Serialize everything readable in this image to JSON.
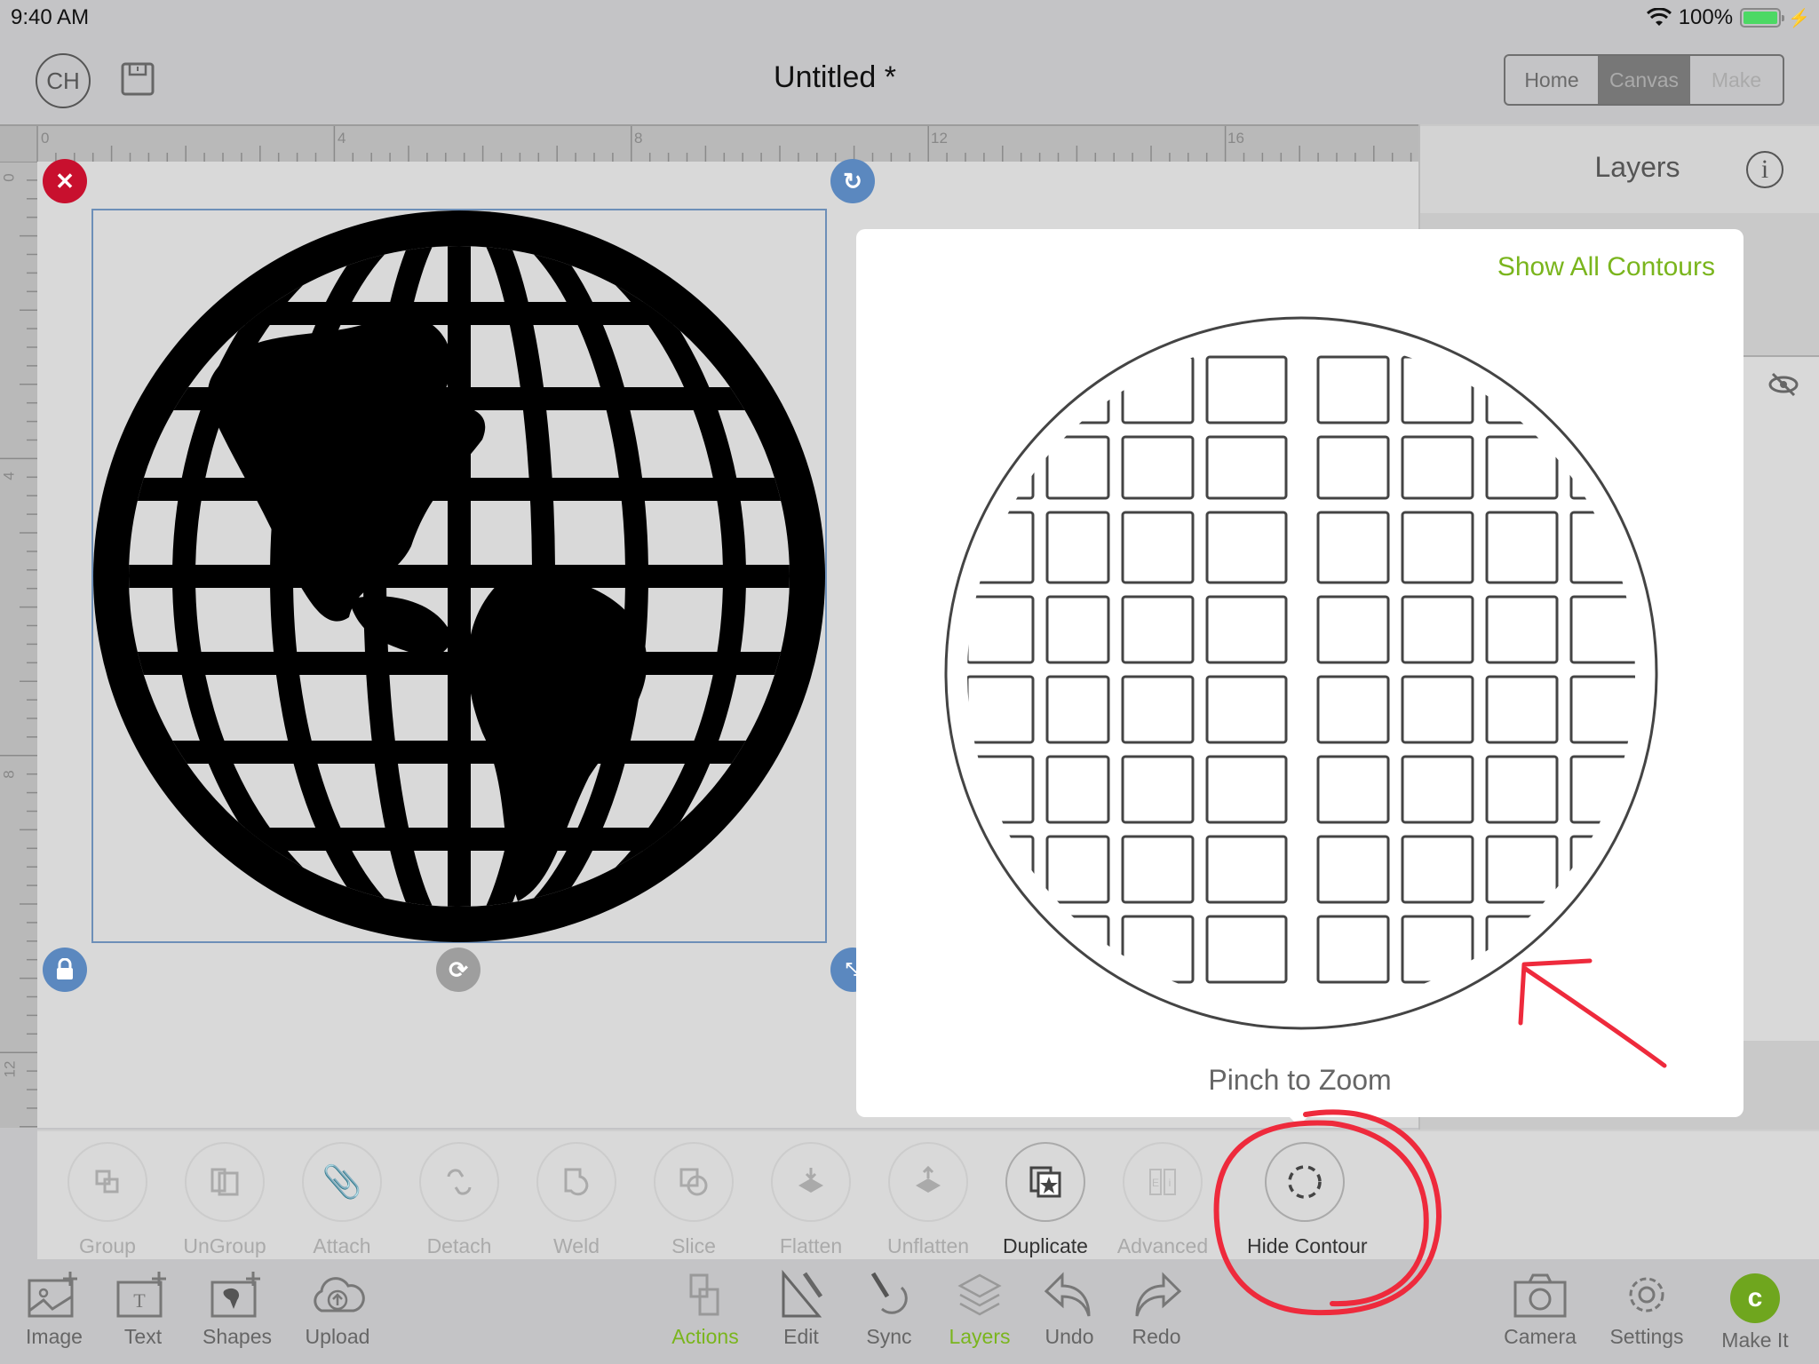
{
  "status_bar": {
    "time": "9:40 AM",
    "battery": "100%",
    "battery_level": 1.0
  },
  "header": {
    "avatar_initials": "CH",
    "title": "Untitled *",
    "nav": [
      {
        "label": "Home",
        "state": "normal"
      },
      {
        "label": "Canvas",
        "state": "active"
      },
      {
        "label": "Make",
        "state": "disabled"
      }
    ]
  },
  "rulers": {
    "horizontal_labels": [
      "0",
      "4",
      "8",
      "12",
      "16"
    ],
    "vertical_labels": [
      "0",
      "4",
      "8",
      "12"
    ],
    "corner_label": "0"
  },
  "layers_panel": {
    "title": "Layers"
  },
  "contour_popover": {
    "show_all_label": "Show All Contours",
    "hint": "Pinch to Zoom"
  },
  "action_bar": {
    "items": [
      {
        "label": "Group",
        "icon": "group-icon",
        "enabled": false
      },
      {
        "label": "UnGroup",
        "icon": "ungroup-icon",
        "enabled": false
      },
      {
        "label": "Attach",
        "icon": "paperclip-icon",
        "enabled": false
      },
      {
        "label": "Detach",
        "icon": "detach-icon",
        "enabled": false
      },
      {
        "label": "Weld",
        "icon": "weld-icon",
        "enabled": false
      },
      {
        "label": "Slice",
        "icon": "slice-icon",
        "enabled": false
      },
      {
        "label": "Flatten",
        "icon": "flatten-icon",
        "enabled": false
      },
      {
        "label": "Unflatten",
        "icon": "unflatten-icon",
        "enabled": false
      },
      {
        "label": "Duplicate",
        "icon": "duplicate-icon",
        "enabled": true
      },
      {
        "label": "Advanced",
        "icon": "advanced-icon",
        "enabled": false
      },
      {
        "label": "Hide Contour",
        "icon": "contour-icon",
        "enabled": true
      }
    ]
  },
  "bottom_toolbar": {
    "left": [
      {
        "label": "Image",
        "icon": "image-add-icon"
      },
      {
        "label": "Text",
        "icon": "text-add-icon"
      },
      {
        "label": "Shapes",
        "icon": "shapes-add-icon"
      },
      {
        "label": "Upload",
        "icon": "cloud-upload-icon"
      }
    ],
    "center": [
      {
        "label": "Actions",
        "icon": "actions-icon",
        "active": true
      },
      {
        "label": "Edit",
        "icon": "edit-icon",
        "active": false
      },
      {
        "label": "Sync",
        "icon": "sync-icon",
        "active": false
      },
      {
        "label": "Layers",
        "icon": "layers-icon",
        "active": true
      },
      {
        "label": "Undo",
        "icon": "undo-icon",
        "active": false
      },
      {
        "label": "Redo",
        "icon": "redo-icon",
        "active": false
      }
    ],
    "right": [
      {
        "label": "Camera",
        "icon": "camera-icon"
      },
      {
        "label": "Settings",
        "icon": "gear-icon"
      },
      {
        "label": "Make It",
        "icon": "make-it-icon"
      }
    ]
  },
  "colors": {
    "accent_green": "#7ab51d",
    "close_red": "#c8102e",
    "handle_blue": "#5b88bf",
    "annotation_red": "#ee2a3c"
  }
}
